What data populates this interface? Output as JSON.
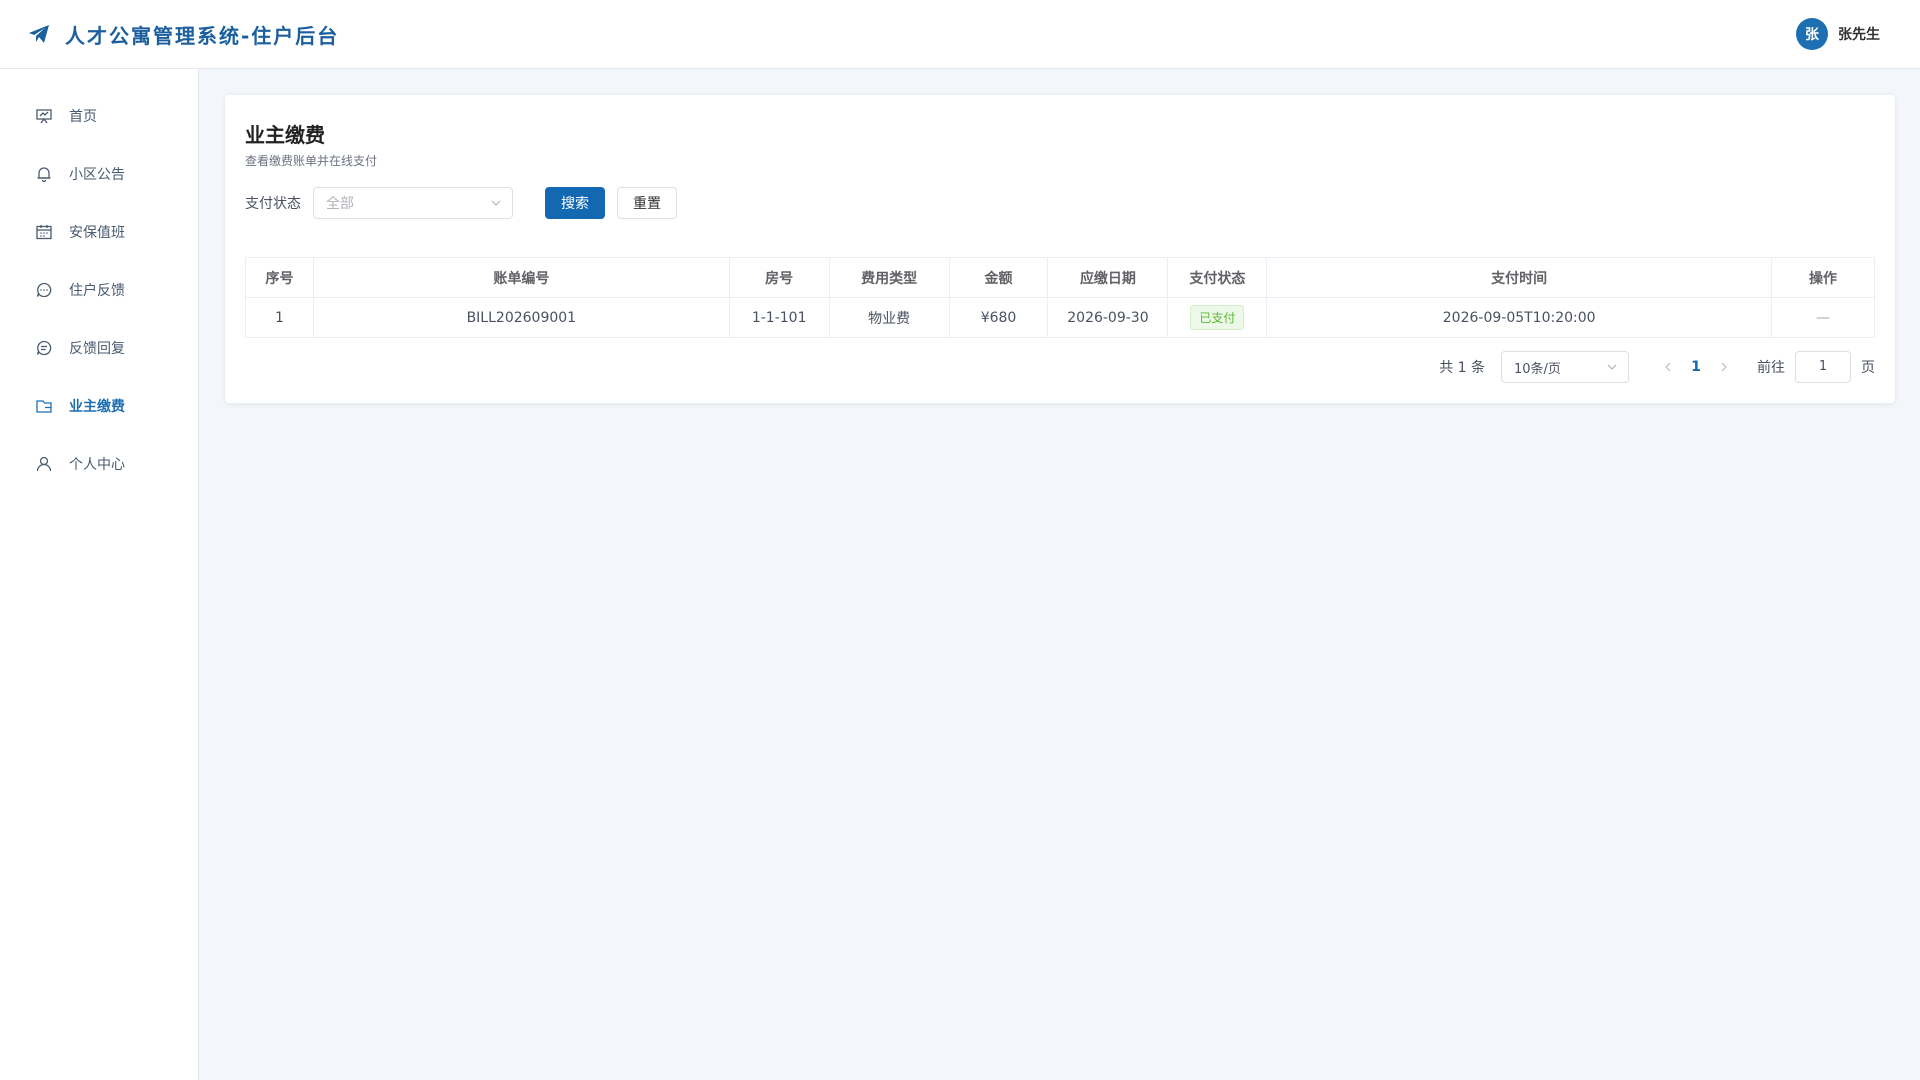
{
  "app": {
    "title": "人才公寓管理系统-住户后台",
    "brand_color": "#1b5f9e",
    "icon": "paper-plane-icon"
  },
  "user": {
    "avatar_text": "张",
    "name": "张先生"
  },
  "sidebar": {
    "items": [
      {
        "label": "首页",
        "icon": "presentation-icon",
        "active": false
      },
      {
        "label": "小区公告",
        "icon": "bell-icon",
        "active": false
      },
      {
        "label": "安保值班",
        "icon": "calendar-icon",
        "active": false
      },
      {
        "label": "住户反馈",
        "icon": "chat-icon",
        "active": false
      },
      {
        "label": "反馈回复",
        "icon": "reply-chat-icon",
        "active": false
      },
      {
        "label": "业主缴费",
        "icon": "wallet-icon",
        "active": true
      },
      {
        "label": "个人中心",
        "icon": "user-icon",
        "active": false
      }
    ]
  },
  "main": {
    "title": "业主缴费",
    "subtitle": "查看缴费账单并在线支付",
    "filter": {
      "label": "支付状态",
      "placeholder": "全部",
      "search_label": "搜索",
      "reset_label": "重置"
    },
    "table": {
      "columns": [
        "序号",
        "账单编号",
        "房号",
        "费用类型",
        "金额",
        "应缴日期",
        "支付状态",
        "支付时间",
        "操作"
      ],
      "rows": [
        [
          "1",
          "BILL202609001",
          "1-1-101",
          "物业费",
          "¥680",
          "2026-09-30",
          "已支付",
          "2026-09-05T10:20:00",
          "—"
        ]
      ]
    },
    "pagination": {
      "total": "共 1 条",
      "page_size": "10条/页",
      "current_page": "1",
      "goto_label": "前往",
      "goto_value": "1",
      "page_unit": "页"
    }
  },
  "colors": {
    "primary": "#1368b2",
    "success": "#5ab833",
    "background": "#f3f6fa"
  }
}
